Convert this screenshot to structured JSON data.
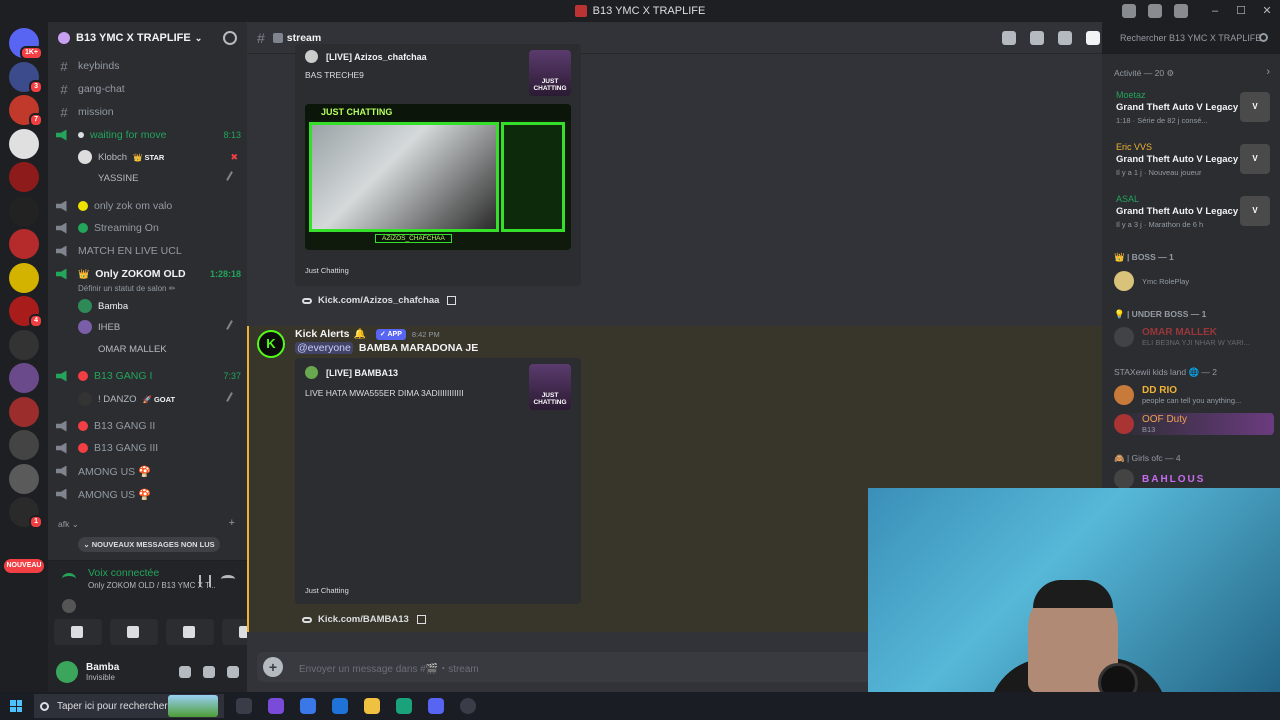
{
  "window": {
    "title": "B13 YMC X TRAPLIFE"
  },
  "servers": {
    "items": [
      {
        "color": "#5865f2",
        "badge": "1K+"
      },
      {
        "color": "#3c4b8c",
        "badge": "3"
      },
      {
        "color": "#c0392b",
        "badge": "7"
      },
      {
        "color": "#e0e0e0",
        "badge": ""
      },
      {
        "color": "#8e1b1b",
        "badge": ""
      },
      {
        "color": "#222222",
        "badge": ""
      },
      {
        "color": "#b52a2a",
        "badge": ""
      },
      {
        "color": "#d4b200",
        "badge": ""
      },
      {
        "color": "#a81c1c",
        "badge": "4"
      },
      {
        "color": "#333333",
        "badge": ""
      },
      {
        "color": "#6b4a8c",
        "badge": ""
      },
      {
        "color": "#9b2d2d",
        "badge": ""
      },
      {
        "color": "#444444",
        "badge": ""
      },
      {
        "color": "#5a5a5a",
        "badge": ""
      },
      {
        "color": "#2a2a2a",
        "badge": "1"
      }
    ],
    "new_label": "NOUVEAU"
  },
  "guild": {
    "name": "B13 YMC X TRAPLIFE"
  },
  "channels": {
    "keybinds": "keybinds",
    "gang_chat": "gang-chat",
    "mission": "mission",
    "waiting": {
      "name": "waiting for move",
      "time": "8:13"
    },
    "waiting_users": [
      {
        "name": "Klobch",
        "tag": "👑 STAR"
      },
      {
        "name": "YASSINE",
        "tag": ""
      }
    ],
    "zok": "only zok om valo",
    "streaming": "Streaming On",
    "match": "MATCH EN LIVE UCL",
    "only_zokom": {
      "name": "Only ZOKOM OLD",
      "time": "1:28:18",
      "status": "Définir un statut de salon ✏"
    },
    "zokom_users": [
      "Bamba",
      "IHEB",
      "OMAR MALLEK"
    ],
    "gang1": {
      "name": "B13 GANG I",
      "time": "7:37"
    },
    "gang1_users": [
      {
        "name": "! DANZO",
        "tag": "🚀 GOAT"
      }
    ],
    "gang2": "B13 GANG II",
    "gang3": "B13 GANG III",
    "among1": "AMONG US 🍄",
    "among2": "AMONG US 🍄",
    "afk": "afk",
    "new_msgs": "NOUVEAUX MESSAGES NON LUS"
  },
  "voice_panel": {
    "title": "Voix connectée",
    "subtitle": "Only ZOKOM OLD / B13 YMC X T..."
  },
  "user_panel": {
    "name": "Bamba",
    "status": "Invisible"
  },
  "channel_header": {
    "name": "stream",
    "search_placeholder": "Rechercher B13 YMC X TRAPLIFE"
  },
  "messages": {
    "embed1": {
      "author": "[LIVE] Azizos_chafchaa",
      "desc": "BAS TRECHE9",
      "banner": "JUST CHATTING",
      "tag": "AZIZOS_CHAFCHAA",
      "footer": "Just Chatting",
      "thumb": "JUST CHATTING"
    },
    "link1": "Kick.com/Azizos_chafchaa",
    "kick": {
      "user": "Kick Alerts",
      "app": "✓ APP",
      "time": "8:42 PM",
      "mention": "@everyone",
      "text": "BAMBA MARADONA JE"
    },
    "embed2": {
      "author": "[LIVE] BAMBA13",
      "desc": "LIVE HATA MWA555ER DIMA 3ADIIIIIIIIIII",
      "footer": "Just Chatting",
      "thumb": "JUST CHATTING"
    },
    "link2": "Kick.com/BAMBA13"
  },
  "composer": {
    "placeholder": "Envoyer un message dans #🎬・stream"
  },
  "members": {
    "activity_header": "Activité — 20",
    "activities": [
      {
        "user": "Moetaz",
        "game": "Grand Theft Auto V Legacy",
        "detail": "1:18 · Série de 82 j consé..."
      },
      {
        "user": "Eric VVS",
        "game": "Grand Theft Auto V Legacy",
        "detail": "Il y a 1 j · Nouveau joueur"
      },
      {
        "user": "ASAL",
        "game": "Grand Theft Auto V Legacy",
        "detail": "Il y a 3 j · Marathon de 6 h"
      }
    ],
    "gta_label": "V",
    "boss_role": "👑 | BOSS — 1",
    "boss_member": {
      "name": "",
      "status": "Ymc RolePlay"
    },
    "underboss_role": "💡 | UNDER BOSS — 1",
    "underboss_member": {
      "name": "OMAR MALLEK",
      "status": "ELI BE3NA YJI NHAR W YARI..."
    },
    "stax_role": "STAXewii kids land 🌐 — 2",
    "stax_members": [
      {
        "name": "DD RIO",
        "status": "people can tell you anything..."
      },
      {
        "name": "OOF Duty",
        "status": "B13"
      }
    ],
    "girls_role": "🙈 | Girls ofc — 4",
    "girls_member": {
      "name": "BAHLOUS"
    }
  },
  "taskbar": {
    "search": "Taper ici pour rechercher"
  }
}
